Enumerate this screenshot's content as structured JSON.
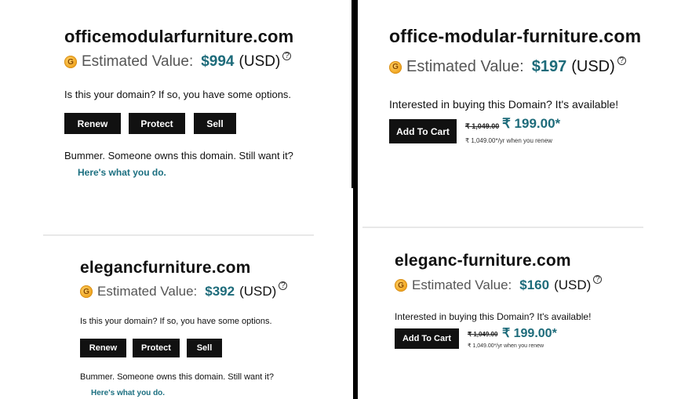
{
  "panels": [
    {
      "domain": "officemodularfurniture.com",
      "estimated_label": "Estimated Value:",
      "value": "$994",
      "currency": "(USD)",
      "help_icon": "?",
      "prompt": "Is this your domain? If so, you have some options.",
      "buttons": [
        "Renew",
        "Protect",
        "Sell"
      ],
      "owned_text": "Bummer. Someone owns this domain. Still want it?",
      "link": "Here's what you do."
    },
    {
      "domain": "office-modular-furniture.com",
      "estimated_label": "Estimated Value:",
      "value": "$197",
      "currency": "(USD)",
      "help_icon": "?",
      "prompt": "Interested in buying this Domain? It's available!",
      "cart_button": "Add To Cart",
      "old_price": "₹ 1,049.00",
      "new_price": "₹ 199.00*",
      "renew_note": "₹ 1,049.00*/yr when you renew"
    },
    {
      "domain": "elegancfurniture.com",
      "estimated_label": "Estimated Value:",
      "value": "$392",
      "currency": "(USD)",
      "help_icon": "?",
      "prompt": "Is this your domain? If so, you have some options.",
      "buttons": [
        "Renew",
        "Protect",
        "Sell"
      ],
      "owned_text": "Bummer. Someone owns this domain. Still want it?",
      "link": "Here's what you do."
    },
    {
      "domain": "eleganc-furniture.com",
      "estimated_label": "Estimated Value:",
      "value": "$160",
      "currency": "(USD)",
      "help_icon": "?",
      "prompt": "Interested in buying this Domain? It's available!",
      "cart_button": "Add To Cart",
      "old_price": "₹ 1,049.00",
      "new_price": "₹ 199.00*",
      "renew_note": "₹ 1,049.00*/yr when you renew"
    }
  ],
  "colors": {
    "value": "#1d6b7a",
    "link": "#1b6f80",
    "button": "#111111",
    "coin": "#f0a21a"
  }
}
